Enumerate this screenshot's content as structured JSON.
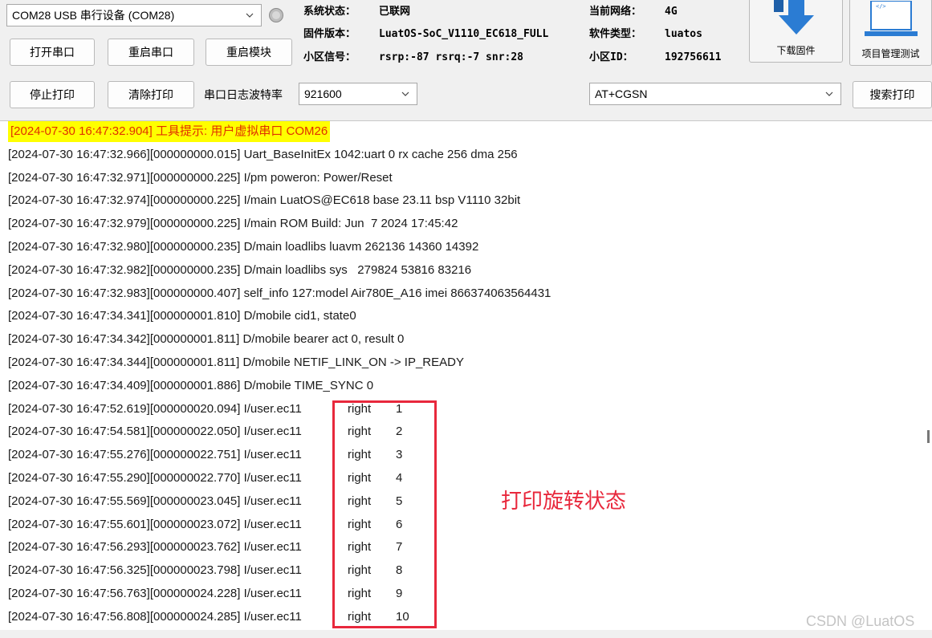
{
  "toolbar": {
    "port_select": "COM28 USB 串行设备 (COM28)",
    "btn_open_port": "打开串口",
    "btn_restart_port": "重启串口",
    "btn_restart_module": "重启模块",
    "btn_stop_print": "停止打印",
    "btn_clear_print": "清除打印",
    "baud_label": "串口日志波特率",
    "baud_value": "921600",
    "at_command": "AT+CGSN",
    "btn_search_print": "搜索打印"
  },
  "status": {
    "sys_state_label": "系统状态：",
    "sys_state_value": "已联网",
    "firmware_label": "固件版本：",
    "firmware_value": "LuatOS-SoC_V1110_EC618_FULL",
    "cell_signal_label": "小区信号：",
    "cell_signal_value": "rsrp:-87 rsrq:-7 snr:28",
    "network_label": "当前网络：",
    "network_value": "4G",
    "software_label": "软件类型：",
    "software_value": "luatos",
    "cell_id_label": "小区ID：",
    "cell_id_value": "192756611"
  },
  "side_buttons": {
    "download_label": "下载固件",
    "project_label": "项目管理测试",
    "project_icon_text": "</>"
  },
  "log": {
    "highlight_line": "[2024-07-30 16:47:32.904] 工具提示: 用户虚拟串口 COM26",
    "lines": [
      "[2024-07-30 16:47:32.966][000000000.015] Uart_BaseInitEx 1042:uart 0 rx cache 256 dma 256",
      "[2024-07-30 16:47:32.971][000000000.225] I/pm poweron: Power/Reset",
      "[2024-07-30 16:47:32.974][000000000.225] I/main LuatOS@EC618 base 23.11 bsp V1110 32bit",
      "[2024-07-30 16:47:32.979][000000000.225] I/main ROM Build: Jun  7 2024 17:45:42",
      "[2024-07-30 16:47:32.980][000000000.235] D/main loadlibs luavm 262136 14360 14392",
      "[2024-07-30 16:47:32.982][000000000.235] D/main loadlibs sys   279824 53816 83216",
      "[2024-07-30 16:47:32.983][000000000.407] self_info 127:model Air780E_A16 imei 866374063564431",
      "[2024-07-30 16:47:34.341][000000001.810] D/mobile cid1, state0",
      "[2024-07-30 16:47:34.342][000000001.811] D/mobile bearer act 0, result 0",
      "[2024-07-30 16:47:34.344][000000001.811] D/mobile NETIF_LINK_ON -> IP_READY",
      "[2024-07-30 16:47:34.409][000000001.886] D/mobile TIME_SYNC 0"
    ],
    "rotation_lines": [
      {
        "prefix": "[2024-07-30 16:47:52.619][000000020.094] I/user.ec11",
        "dir": "right",
        "count": "1"
      },
      {
        "prefix": "[2024-07-30 16:47:54.581][000000022.050] I/user.ec11",
        "dir": "right",
        "count": "2"
      },
      {
        "prefix": "[2024-07-30 16:47:55.276][000000022.751] I/user.ec11",
        "dir": "right",
        "count": "3"
      },
      {
        "prefix": "[2024-07-30 16:47:55.290][000000022.770] I/user.ec11",
        "dir": "right",
        "count": "4"
      },
      {
        "prefix": "[2024-07-30 16:47:55.569][000000023.045] I/user.ec11",
        "dir": "right",
        "count": "5"
      },
      {
        "prefix": "[2024-07-30 16:47:55.601][000000023.072] I/user.ec11",
        "dir": "right",
        "count": "6"
      },
      {
        "prefix": "[2024-07-30 16:47:56.293][000000023.762] I/user.ec11",
        "dir": "right",
        "count": "7"
      },
      {
        "prefix": "[2024-07-30 16:47:56.325][000000023.798] I/user.ec11",
        "dir": "right",
        "count": "8"
      },
      {
        "prefix": "[2024-07-30 16:47:56.763][000000024.228] I/user.ec11",
        "dir": "right",
        "count": "9"
      },
      {
        "prefix": "[2024-07-30 16:47:56.808][000000024.285] I/user.ec11",
        "dir": "right",
        "count": "10"
      }
    ]
  },
  "annotation": "打印旋转状态",
  "watermark": "CSDN @LuatOS",
  "colors": {
    "highlight_bg": "#ffff00",
    "highlight_text": "#e03000",
    "annotation_red": "#e8283c",
    "icon_blue": "#2b7cd3"
  }
}
